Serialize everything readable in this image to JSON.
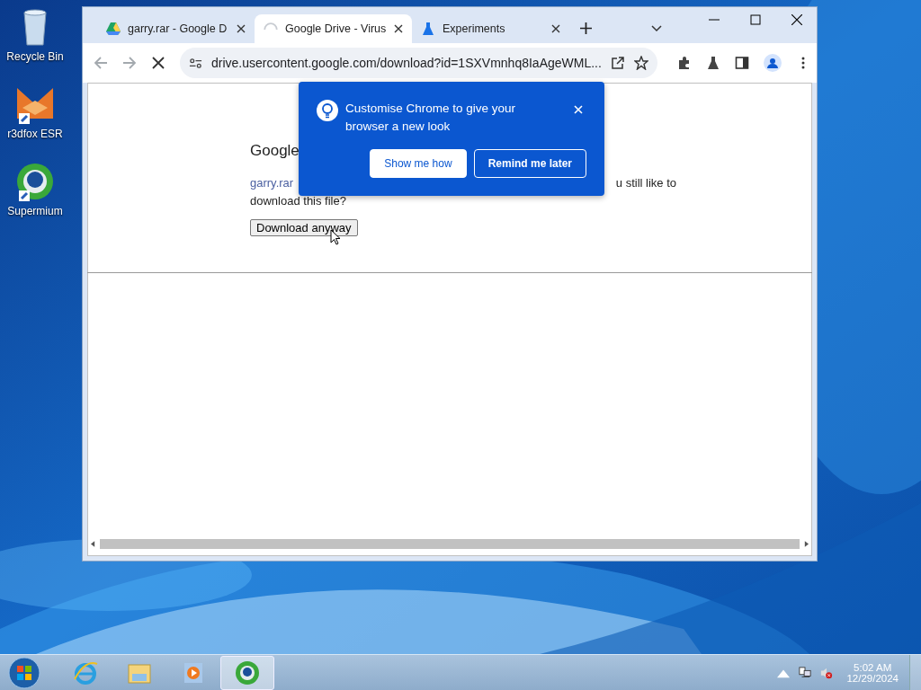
{
  "desktop_icons": [
    {
      "label": "Recycle Bin",
      "kind": "bin"
    },
    {
      "label": "r3dfox ESR",
      "kind": "fox"
    },
    {
      "label": "Supermium",
      "kind": "supermium"
    }
  ],
  "browser": {
    "tabs": [
      {
        "title": "garry.rar - Google D",
        "kind": "drive",
        "selected": false
      },
      {
        "title": "Google Drive - Virus",
        "kind": "loading",
        "selected": true
      },
      {
        "title": "Experiments",
        "kind": "experiments",
        "selected": false
      }
    ],
    "loading": true,
    "address": "drive.usercontent.google.com/download?id=1SXVmnhq8IaAgeWML...",
    "page": {
      "heading": "Google",
      "link": "garry.rar",
      "text_right": "u still like to",
      "text_line2": "download this file?",
      "button": "Download anyway"
    },
    "popup": {
      "message": "Customise Chrome to give your browser a new look",
      "buttons": [
        {
          "label": "Show me how",
          "kind": "secondary"
        },
        {
          "label": "Remind me later",
          "kind": "primary"
        }
      ]
    }
  },
  "taskbar": {
    "apps": [
      {
        "kind": "ie",
        "selected": false
      },
      {
        "kind": "explorer",
        "selected": false
      },
      {
        "kind": "media",
        "selected": false
      },
      {
        "kind": "supermium",
        "selected": true
      }
    ],
    "time": "5:02 AM",
    "date": "12/29/2024"
  }
}
